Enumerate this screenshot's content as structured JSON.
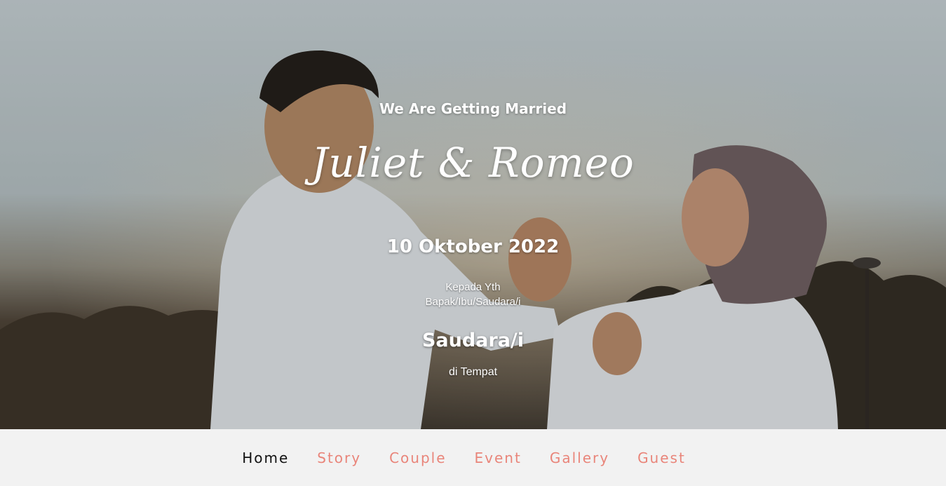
{
  "hero": {
    "subtitle": "We Are Getting Married",
    "names": "Juliet & Romeo",
    "date": "10 Oktober 2022",
    "greeting_line1": "Kepada Yth",
    "greeting_line2": "Bapak/Ibu/Saudara/i",
    "guest_name": "Saudara/i",
    "place_line": "di Tempat"
  },
  "nav": {
    "items": [
      {
        "label": "Home",
        "active": true
      },
      {
        "label": "Story",
        "active": false
      },
      {
        "label": "Couple",
        "active": false
      },
      {
        "label": "Event",
        "active": false
      },
      {
        "label": "Gallery",
        "active": false
      },
      {
        "label": "Guest",
        "active": false
      }
    ]
  },
  "colors": {
    "nav_active": "#111111",
    "nav_inactive": "#e9857a",
    "nav_background": "#f2f2f2",
    "hero_text": "#ffffff"
  }
}
